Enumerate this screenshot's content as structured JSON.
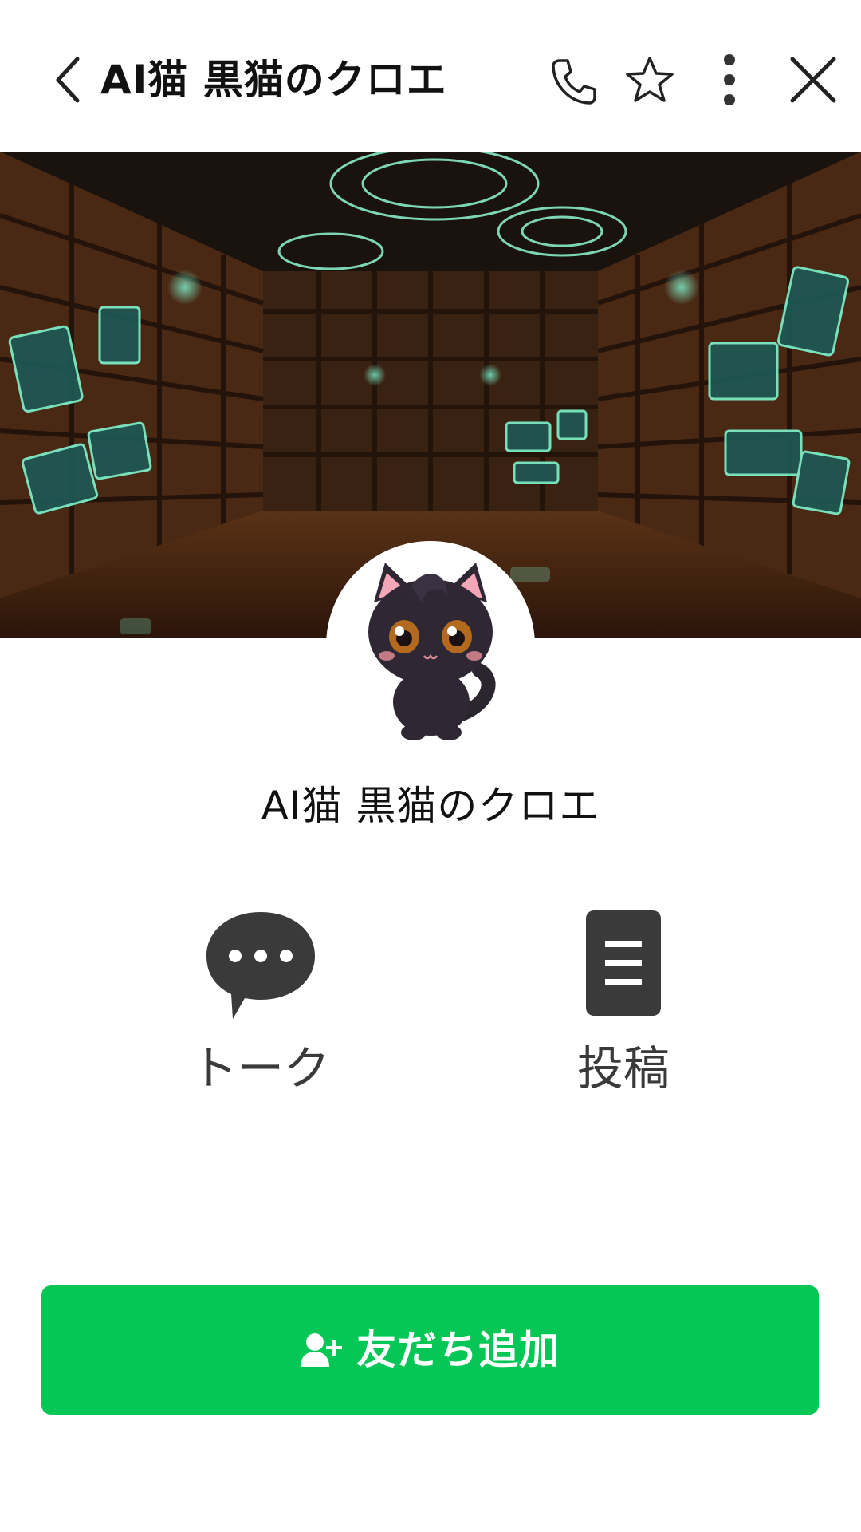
{
  "header": {
    "title": "AI猫 黒猫のクロエ",
    "icons": {
      "back": "chevron-left-icon",
      "call": "phone-icon",
      "favorite": "star-icon",
      "menu": "more-vertical-icon",
      "close": "close-icon"
    }
  },
  "cover": {
    "description_icon": "library-cover-image"
  },
  "profile": {
    "name": "AI猫 黒猫のクロエ",
    "avatar_icon": "black-cat-avatar"
  },
  "actions": [
    {
      "label": "トーク",
      "icon": "speech-bubble-icon"
    },
    {
      "label": "投稿",
      "icon": "post-document-icon"
    }
  ],
  "add_friend": {
    "label": "友だち追加",
    "icon": "add-user-icon",
    "color": "#06c755"
  },
  "colors": {
    "accent_green": "#06c755",
    "icon_dark": "#3a3a3a",
    "text": "#111111"
  }
}
